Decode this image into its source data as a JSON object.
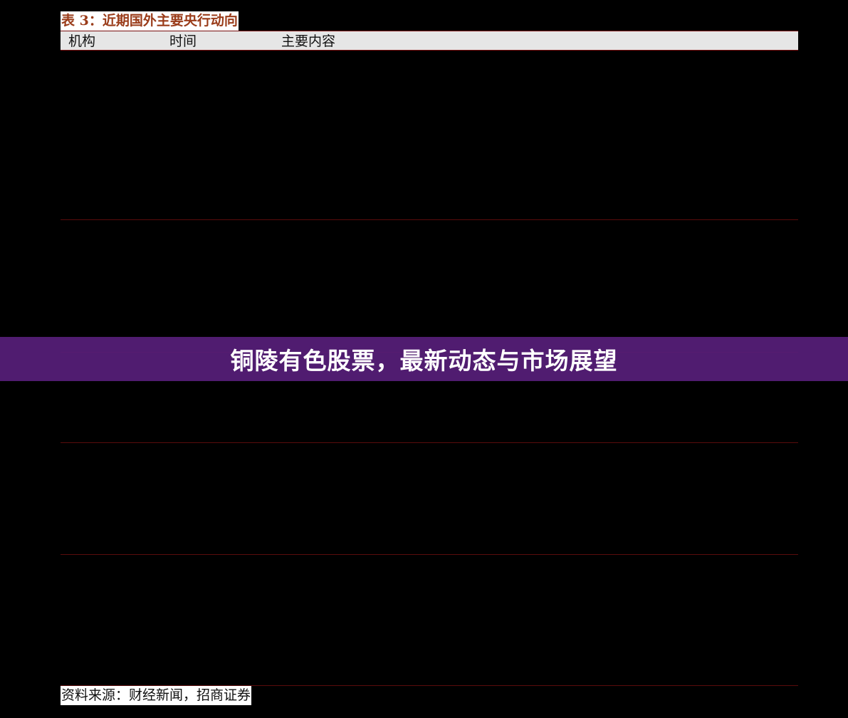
{
  "table": {
    "caption": "表 3：近期国外主要央行动向",
    "headers": {
      "institution": "机构",
      "time": "时间",
      "content": "主要内容"
    }
  },
  "banner": {
    "title": "铜陵有色股票，最新动态与市场展望"
  },
  "source": {
    "note": "资料来源：财经新闻，招商证券"
  }
}
